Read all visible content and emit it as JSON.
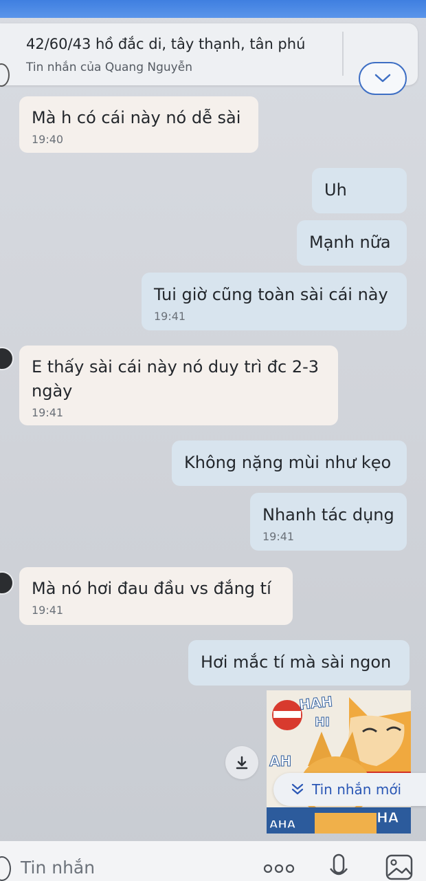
{
  "pinned": {
    "title": "42/60/43 hồ đắc di, tây thạnh, tân phú",
    "subtitle": "Tin nhắn của Quang Nguyễn"
  },
  "messages": [
    {
      "text": "Mà h có cái này nó dễ sài",
      "time": "19:40"
    },
    {
      "text": "Uh"
    },
    {
      "text": "Mạnh nữa"
    },
    {
      "text": "Tui giờ cũng toàn sài cái này",
      "time": "19:41"
    },
    {
      "text": "E thấy sài cái này nó duy trì đc 2-3 ngày",
      "time": "19:41"
    },
    {
      "text": "Không nặng mùi như kẹo"
    },
    {
      "text": "Nhanh tác dụng",
      "time": "19:41"
    },
    {
      "text": "Mà nó hơi đau đầu vs đắng tí",
      "time": "19:41"
    },
    {
      "text": "Hơi mắc tí mà sài ngon"
    }
  ],
  "sticker": {
    "t1": "HAH",
    "t2": "HI",
    "t3": "AH",
    "t4": "AHA",
    "t5": "HA"
  },
  "new_messages_label": "Tin nhắn mới",
  "input": {
    "placeholder": "Tin nhắn"
  },
  "colors": {
    "accent": "#2a57b5",
    "sent_bubble": "#d8e4ee",
    "recv_bubble": "#f5f0ec"
  }
}
